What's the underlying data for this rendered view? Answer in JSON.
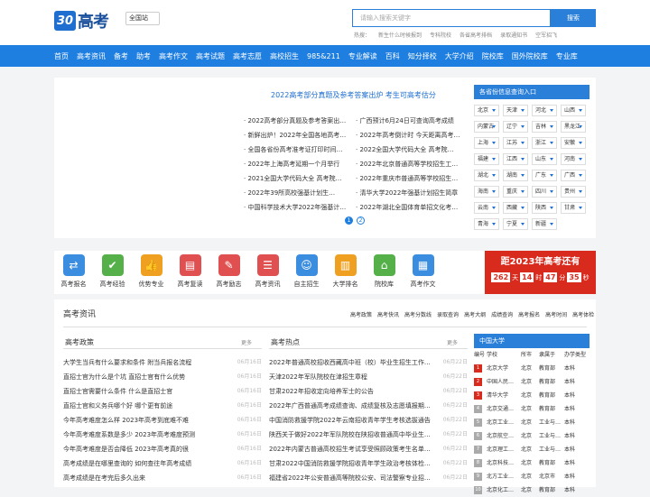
{
  "header": {
    "logo_mark": "30",
    "logo_text": "高考",
    "region": "全国站",
    "search_placeholder": "请输入搜索关键字",
    "search_button": "搜索",
    "hot_label": "热搜：",
    "hot_words": [
      "新生什么时候报到",
      "专科院校",
      "各省高考排档",
      "录取通知书",
      "空军招飞"
    ]
  },
  "nav": [
    "首页",
    "高考资讯",
    "备考",
    "助考",
    "高考作文",
    "高考试题",
    "高考志愿",
    "高校招生",
    "985&211",
    "专业解读",
    "百科",
    "知分择校",
    "大学介绍",
    "院校库",
    "国外院校库",
    "专业库"
  ],
  "banner": {
    "headline": "2022高考部分真题及参考答案出炉 考生可高考估分",
    "col1": [
      "2022高考部分真题及参考答案出…",
      "新鲜出炉！2022年全国各地高考…",
      "全国各省份高考准考证打印时间…",
      "2022年上海高考延期一个月举行",
      "2021全国大学代码大全 高考院…",
      "2022年39所高校强基计划生…",
      "中国科学技术大学2022年强基计…"
    ],
    "col2": [
      "广西预计6月24日可查询高考成绩",
      "2022年高考倒计时 今天距离高考…",
      "2022全国大学代码大全 高考院…",
      "2022年北京普通高等学校招生工…",
      "2022年重庆市普通高等学校招生…",
      "清华大学2022年强基计划招生简章",
      "2022年湖北全国体育单招文化考…"
    ],
    "pages": [
      "1",
      "2"
    ]
  },
  "provinces": {
    "title": "各省份信息查询入口",
    "items": [
      "北京",
      "天津",
      "河北",
      "山西",
      "内蒙古",
      "辽宁",
      "吉林",
      "黑龙江",
      "上海",
      "江苏",
      "浙江",
      "安徽",
      "福建",
      "江西",
      "山东",
      "河南",
      "湖北",
      "湖南",
      "广东",
      "广西",
      "海南",
      "重庆",
      "四川",
      "贵州",
      "云南",
      "西藏",
      "陕西",
      "甘肃",
      "青海",
      "宁夏",
      "新疆"
    ]
  },
  "tools": [
    {
      "label": "高考报名",
      "icon": "signpost-icon",
      "color": "#3b8de0"
    },
    {
      "label": "高考经验",
      "icon": "certificate-icon",
      "color": "#55b04a"
    },
    {
      "label": "优势专业",
      "icon": "thumb-up-icon",
      "color": "#f0a020"
    },
    {
      "label": "高考复读",
      "icon": "book-icon",
      "color": "#e05050"
    },
    {
      "label": "高考励志",
      "icon": "pen-icon",
      "color": "#e05050"
    },
    {
      "label": "高考资讯",
      "icon": "news-icon",
      "color": "#e05050"
    },
    {
      "label": "自主招生",
      "icon": "person-icon",
      "color": "#3b8de0"
    },
    {
      "label": "大学排名",
      "icon": "bar-chart-icon",
      "color": "#f0a020"
    },
    {
      "label": "院校库",
      "icon": "building-icon",
      "color": "#55b04a"
    },
    {
      "label": "高考作文",
      "icon": "document-icon",
      "color": "#3b8de0"
    }
  ],
  "countdown": {
    "title": "距2023年高考还有",
    "days": "262",
    "days_unit": "天",
    "hours": "14",
    "hours_unit": "时",
    "minutes": "47",
    "minutes_unit": "分",
    "seconds": "35",
    "seconds_unit": "秒"
  },
  "info": {
    "title": "高考资讯",
    "links": [
      "高考政策",
      "高考快讯",
      "高考分数线",
      "录取查询",
      "高考大纲",
      "成绩查询",
      "高考报名",
      "高考时间",
      "高考体检"
    ],
    "policy": {
      "title": "高考政策",
      "more": "更多",
      "items": [
        {
          "t": "大学生当兵有什么要求和条件 附当兵报名流程",
          "d": "06月16日"
        },
        {
          "t": "直招士官为什么是个坑 直招士官有什么优势",
          "d": "06月16日"
        },
        {
          "t": "直招士官需要什么条件 什么是直招士官",
          "d": "06月16日"
        },
        {
          "t": "直招士官和义务兵哪个好 哪个更有前途",
          "d": "06月16日"
        },
        {
          "t": "今年高考难度怎么样 2023年高考到底难不难",
          "d": "06月16日"
        },
        {
          "t": "今年高考难度系数是多少 2023年高考难度预测",
          "d": "06月16日"
        },
        {
          "t": "今年高考难度是否会降低 2023年高考真的很",
          "d": "06月16日"
        },
        {
          "t": "高考成绩是在哪里查询的 如何查往年高考成绩",
          "d": "06月16日"
        },
        {
          "t": "高考成绩是在考完后多久出来",
          "d": "06月16日"
        }
      ]
    },
    "hot": {
      "title": "高考热点",
      "more": "更多",
      "items": [
        {
          "t": "2022年普通高校招收西藏高中班（校）毕业生招生工作…",
          "d": "06月22日"
        },
        {
          "t": "天津2022年军队院校在津招生章程",
          "d": "06月22日"
        },
        {
          "t": "甘肃2022年招收定向培养军士的公告",
          "d": "06月22日"
        },
        {
          "t": "2022年广西普通高考成绩查询、成绩复核及志愿填报期…",
          "d": "06月22日"
        },
        {
          "t": "中国消防救援学院2022年云南招收青年学生考核选拔通告",
          "d": "06月22日"
        },
        {
          "t": "陕西关于做好2022年军队院校在陕招收普通高中毕业生…",
          "d": "06月22日"
        },
        {
          "t": "2022年内蒙古普通高校招生考试享受照顾政策考生名单公示",
          "d": "06月22日"
        },
        {
          "t": "甘肃2022中国消防救援学院招收青年学生政治考核体检…",
          "d": "06月22日"
        },
        {
          "t": "福建省2022年公安普通高等院校公安、司法警察专业招…",
          "d": "06月22日"
        }
      ]
    },
    "univ": {
      "title": "中国大学",
      "head": [
        "编号",
        "学校",
        "所市",
        "隶属于",
        "办学类型"
      ],
      "rows": [
        [
          "1",
          "北京大学",
          "北京",
          "教育部",
          "本科"
        ],
        [
          "2",
          "中国人民…",
          "北京",
          "教育部",
          "本科"
        ],
        [
          "3",
          "清华大学",
          "北京",
          "教育部",
          "本科"
        ],
        [
          "4",
          "北京交通…",
          "北京",
          "教育部",
          "本科"
        ],
        [
          "5",
          "北京工业…",
          "北京",
          "工业与…",
          "本科"
        ],
        [
          "6",
          "北京航空…",
          "北京",
          "工业与…",
          "本科"
        ],
        [
          "7",
          "北京理工…",
          "北京",
          "工业与…",
          "本科"
        ],
        [
          "8",
          "北京科技…",
          "北京",
          "教育部",
          "本科"
        ],
        [
          "9",
          "北方工业…",
          "北京",
          "北京市",
          "本科"
        ],
        [
          "10",
          "北京化工…",
          "北京",
          "教育部",
          "本科"
        ]
      ],
      "rank_colors": [
        "#d92a1e",
        "#d92a1e",
        "#d92a1e",
        "#aaaaaa",
        "#aaaaaa",
        "#aaaaaa",
        "#aaaaaa",
        "#aaaaaa",
        "#aaaaaa",
        "#aaaaaa"
      ]
    }
  }
}
